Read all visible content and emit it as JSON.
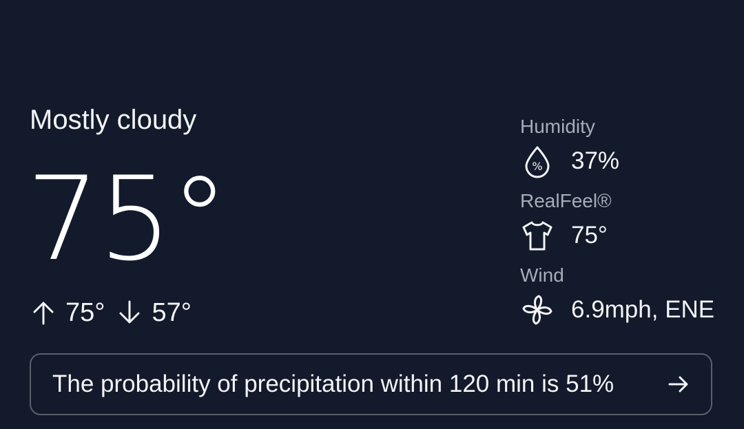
{
  "weather": {
    "condition": "Mostly cloudy",
    "temperature": "75°",
    "high": "75°",
    "low": "57°"
  },
  "details": {
    "humidity": {
      "label": "Humidity",
      "value": "37%",
      "icon": "humidity-drop-icon"
    },
    "realfeel": {
      "label": "RealFeel®",
      "value": "75°",
      "icon": "tshirt-icon"
    },
    "wind": {
      "label": "Wind",
      "value": "6.9mph, ENE",
      "icon": "fan-icon"
    }
  },
  "precipitation_banner": {
    "text": "The probability of precipitation within 120 min is 51%"
  },
  "colors": {
    "background": "#121a2b",
    "text": "#f3f4f6",
    "label": "#a7adb8",
    "border": "#5a606c"
  }
}
